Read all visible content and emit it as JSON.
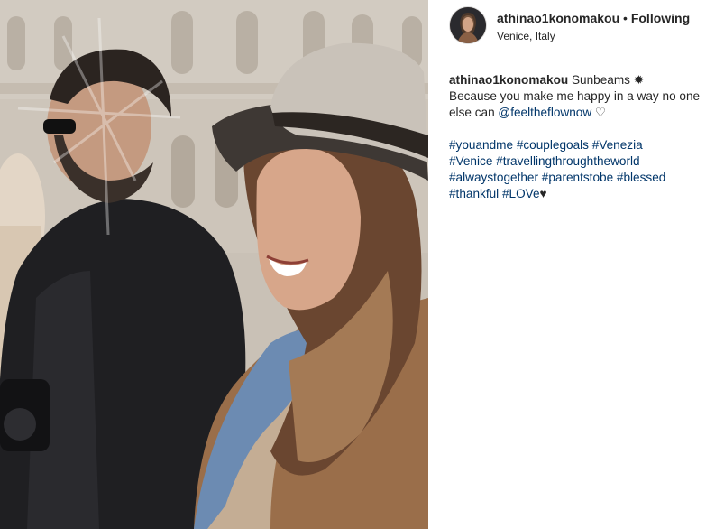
{
  "post": {
    "username": "athinao1konomakou",
    "separator": " • ",
    "follow_label": "Following",
    "location": "Venice, Italy"
  },
  "caption": {
    "username": "athinao1konomakou",
    "line1_rest": " Sunbeams ✹",
    "line2": "Because you make me happy in a way no one else can ",
    "mention": "@feeltheflownow",
    "line2_end": " ♡",
    "hashtags_line1": [
      "#youandme",
      "#couplegoals",
      "#Venezia"
    ],
    "hashtags_line2": [
      "#Venice",
      "#travellingthroughtheworld"
    ],
    "hashtags_line3": [
      "#alwaystogether",
      "#parentstobe",
      "#blessed"
    ],
    "hashtags_line4": [
      "#thankful",
      "#LOVe"
    ],
    "heart": "♥"
  },
  "photo": {
    "alt_subject": "couple-in-venice"
  }
}
